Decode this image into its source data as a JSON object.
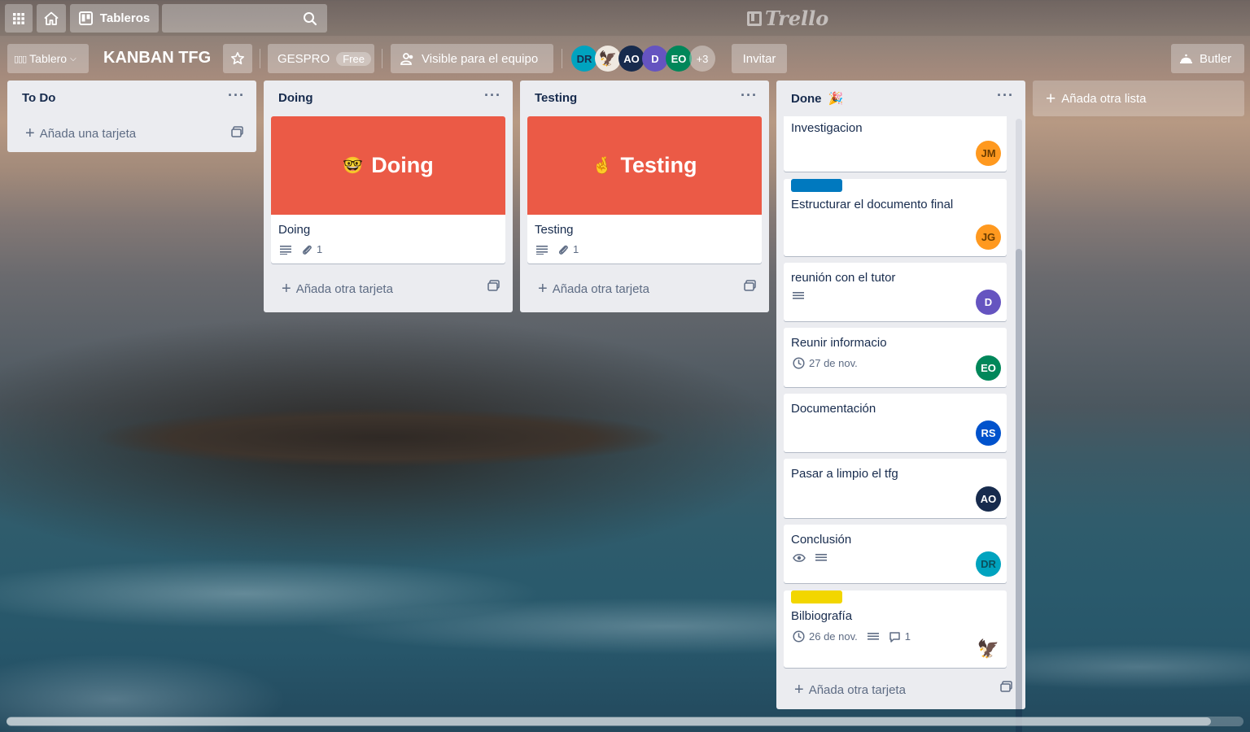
{
  "header": {
    "boards_label": "Tableros",
    "logo_text": "Trello"
  },
  "board": {
    "view_label": "Tablero",
    "title": "KANBAN TFG",
    "team_name": "GESPRO",
    "team_plan": "Free",
    "visibility_label": "Visible para el equipo",
    "members": [
      {
        "initials": "DR",
        "color": "#00a3bf"
      },
      {
        "initials": "",
        "color": "#e6e0d8"
      },
      {
        "initials": "AO",
        "color": "#172b4d"
      },
      {
        "initials": "D",
        "color": "#6554c0"
      },
      {
        "initials": "EO",
        "color": "#00875a"
      }
    ],
    "more_members": "+3",
    "invite_label": "Invitar",
    "butler_label": "Butler"
  },
  "lists": {
    "todo": {
      "title": "To Do",
      "add_card": "Añada una tarjeta"
    },
    "doing": {
      "title": "Doing",
      "cover_emoji": "🤓",
      "cover_text": "Doing",
      "card_title": "Doing",
      "attachments": "1",
      "add_card": "Añada otra tarjeta"
    },
    "testing": {
      "title": "Testing",
      "cover_emoji": "🤞",
      "cover_text": "Testing",
      "card_title": "Testing",
      "attachments": "1",
      "add_card": "Añada otra tarjeta"
    },
    "done": {
      "title": "Done",
      "title_emoji": "🎉",
      "add_card": "Añada otra tarjeta",
      "cards": [
        {
          "title": "Investigacion",
          "member": "JM",
          "member_color": "#ff991f"
        },
        {
          "title": "Estructurar el documento final",
          "label_color": "#0079bf",
          "member": "JG",
          "member_color": "#ff991f"
        },
        {
          "title": "reunión con el tutor",
          "member": "D",
          "member_color": "#6554c0"
        },
        {
          "title": "Reunir informacio",
          "due": "27 de nov.",
          "member": "EO",
          "member_color": "#00875a"
        },
        {
          "title": "Documentación",
          "member": "RS",
          "member_color": "#0052cc"
        },
        {
          "title": "Pasar a limpio el tfg",
          "member": "AO",
          "member_color": "#172b4d"
        },
        {
          "title": "Conclusión",
          "member": "DR",
          "member_color": "#00a3bf"
        },
        {
          "title": "Bilbiografía",
          "label_color": "#f2d600",
          "due": "26 de nov.",
          "comments": "1"
        }
      ]
    }
  },
  "add_list_label": "Añada otra lista",
  "colors": {
    "cover": "#eb5a46",
    "list_bg": "#ebecf0"
  }
}
